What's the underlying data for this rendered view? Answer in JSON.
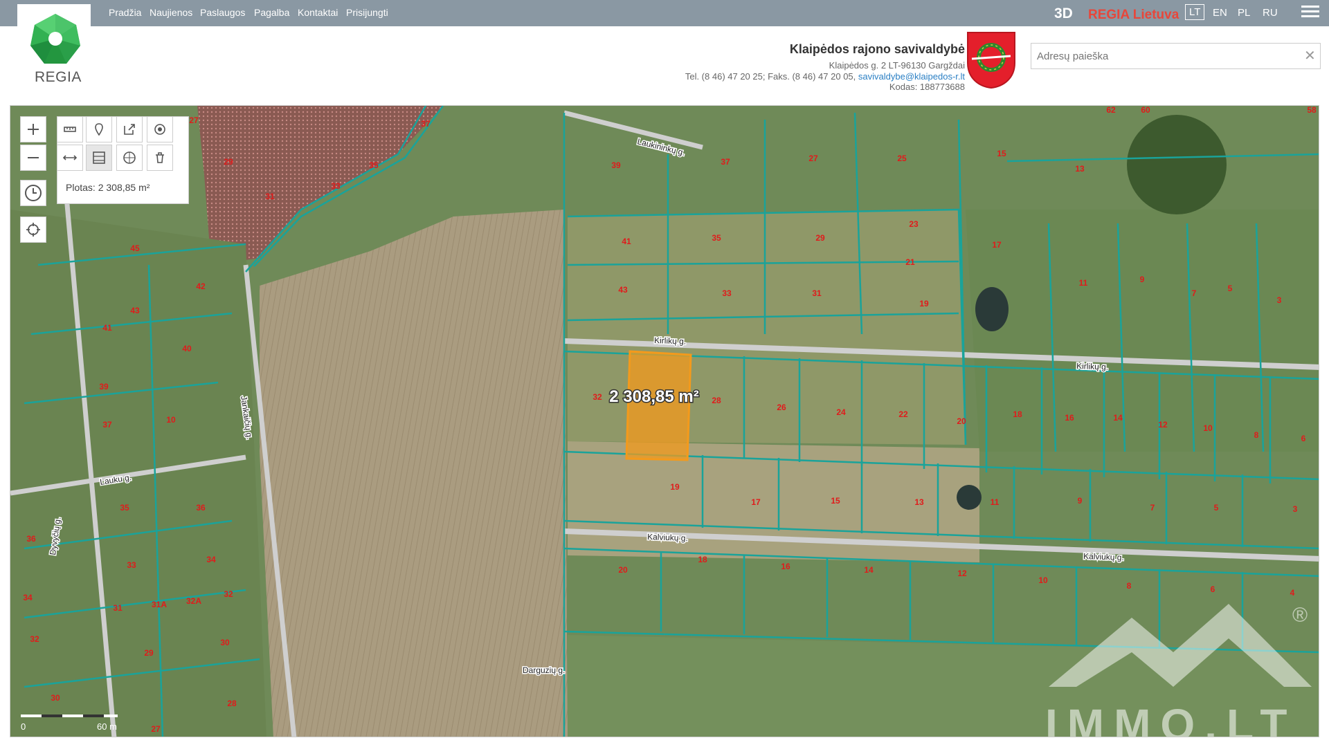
{
  "nav": {
    "links": [
      "Pradžia",
      "Naujienos",
      "Paslaugos",
      "Pagalba",
      "Kontaktai",
      "Prisijungti"
    ],
    "btn_3d": "3D",
    "brand": "REGIA Lietuva",
    "languages": [
      "LT",
      "EN",
      "PL",
      "RU"
    ],
    "active_language": "LT"
  },
  "header": {
    "logo_text": "REGIA",
    "municipality": "Klaipėdos rajono savivaldybė",
    "address": "Klaipėdos g. 2 LT-96130 Gargždai",
    "phones": "Tel. (8 46) 47 20 25; Faks. (8 46) 47 20 05, ",
    "email": "savivaldybe@klaipedos-r.lt",
    "code": "Kodas: 188773688"
  },
  "search": {
    "placeholder": "Adresų paieška",
    "clear_icon": "close-icon"
  },
  "map": {
    "area_readout": "Plotas: 2 308,85 m²",
    "area_label": "2 308,85 m²",
    "scale": {
      "start": "0",
      "end": "60 m"
    },
    "street_labels": [
      "Laukininkų g.",
      "Kirlikų g.",
      "Kirlikų g.",
      "Kalviukų g.",
      "Kalviukų g.",
      "Lauku g.",
      "Dyvyčių g.",
      "Jankaičių g.",
      "Darguzių g."
    ],
    "parcel_labels": [
      "27",
      "29",
      "37",
      "33",
      "35",
      "31",
      "45",
      "42",
      "43",
      "41",
      "40",
      "39",
      "37",
      "10",
      "35",
      "36",
      "36",
      "33",
      "34",
      "34",
      "31",
      "31A",
      "32A",
      "32",
      "32",
      "29",
      "30",
      "30",
      "27",
      "28",
      "39",
      "37",
      "27",
      "25",
      "15",
      "13",
      "62",
      "60",
      "58",
      "41",
      "35",
      "29",
      "23",
      "17",
      "43",
      "33",
      "31",
      "21",
      "19",
      "11",
      "9",
      "7",
      "5",
      "3",
      "32",
      "28",
      "26",
      "24",
      "22",
      "20",
      "18",
      "16",
      "14",
      "12",
      "10",
      "8",
      "6",
      "19",
      "17",
      "15",
      "13",
      "11",
      "9",
      "7",
      "5",
      "3",
      "20",
      "18",
      "16",
      "14",
      "12",
      "10",
      "8",
      "6",
      "4"
    ],
    "watermark": "IMMO.LT",
    "registered_mark": "®"
  },
  "colors": {
    "topbar": "#8a98a3",
    "brand": "#e8463a",
    "parcel_line": "#1aa39a",
    "selection": "#f39a1c",
    "label": "#e01b1b"
  }
}
